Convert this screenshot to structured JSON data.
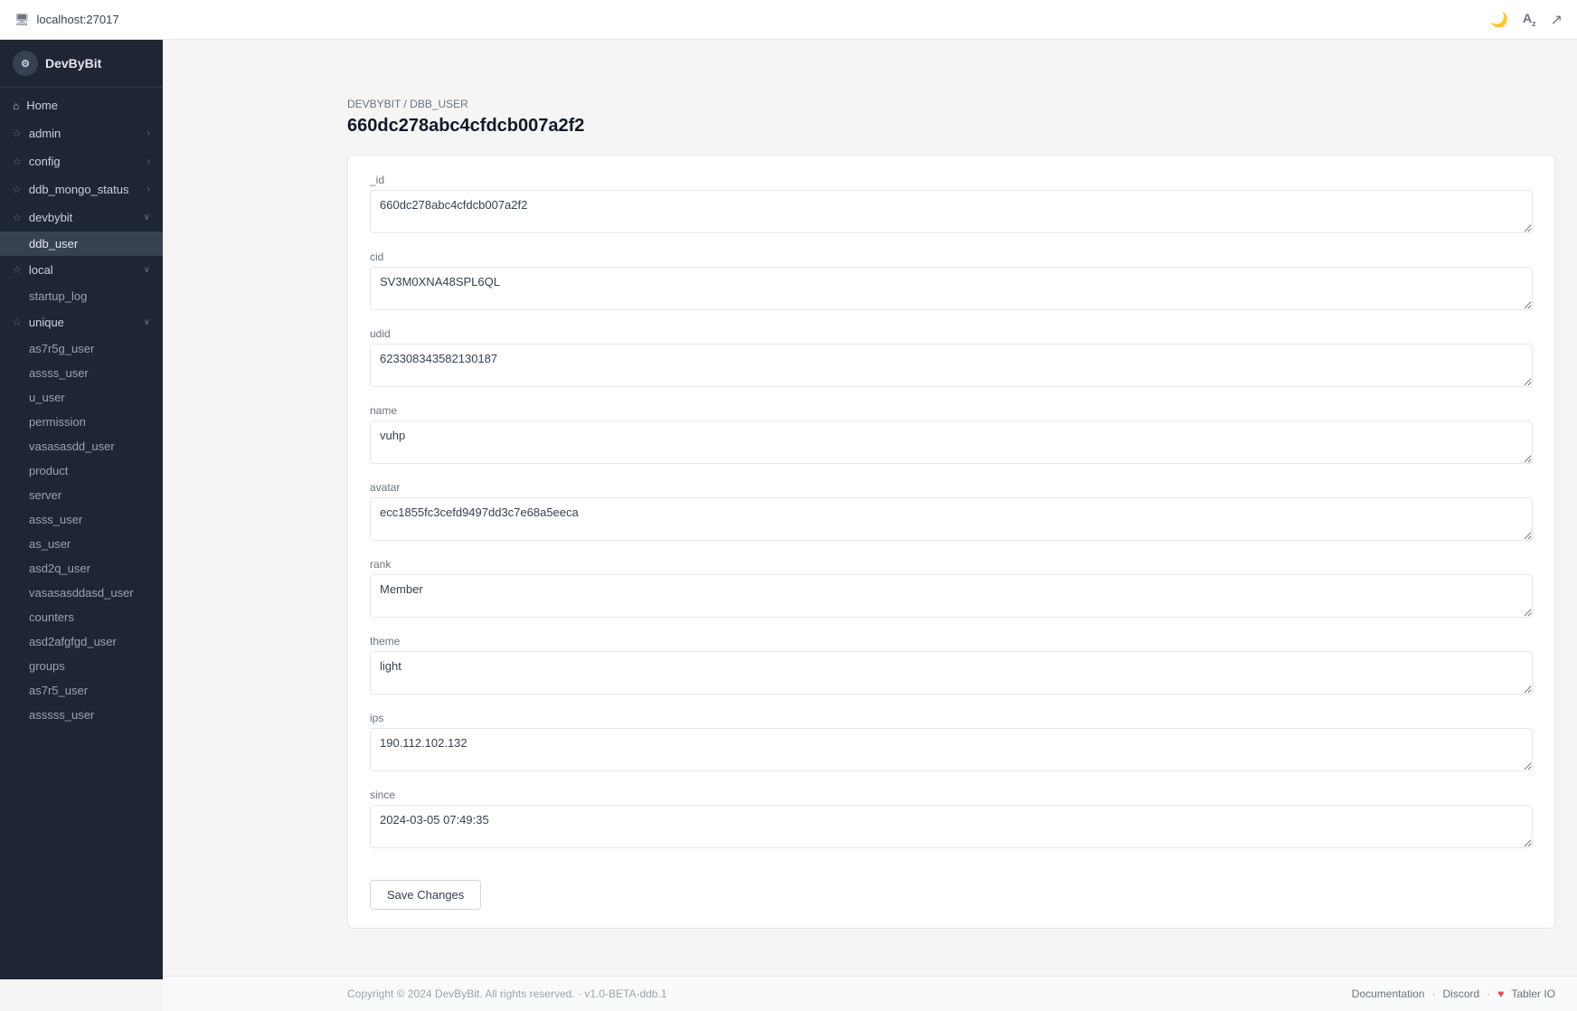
{
  "topbar": {
    "url": "localhost:27017",
    "moon_icon": "🌙",
    "translate_icon": "A",
    "external_icon": "↗"
  },
  "sidebar": {
    "logo": "DevByBit",
    "items": [
      {
        "id": "home",
        "label": "Home",
        "icon": "⌂",
        "hasChildren": false
      },
      {
        "id": "admin",
        "label": "admin",
        "icon": "☆",
        "hasChildren": true,
        "expanded": false
      },
      {
        "id": "config",
        "label": "config",
        "icon": "☆",
        "hasChildren": true,
        "expanded": false
      },
      {
        "id": "ddb_mongo_status",
        "label": "ddb_mongo_status",
        "icon": "☆",
        "hasChildren": true,
        "expanded": false
      },
      {
        "id": "devbybit",
        "label": "devbybit",
        "icon": "☆",
        "hasChildren": true,
        "expanded": true,
        "children": [
          {
            "id": "ddb_user",
            "label": "ddb_user",
            "active": true
          }
        ]
      },
      {
        "id": "local",
        "label": "local",
        "icon": "☆",
        "hasChildren": true,
        "expanded": true,
        "children": [
          {
            "id": "startup_log",
            "label": "startup_log"
          }
        ]
      },
      {
        "id": "unique",
        "label": "unique",
        "icon": "☆",
        "hasChildren": true,
        "expanded": true,
        "children": [
          {
            "id": "as7r5g_user",
            "label": "as7r5g_user"
          },
          {
            "id": "assss_user",
            "label": "assss_user"
          },
          {
            "id": "u_user",
            "label": "u_user"
          },
          {
            "id": "permission",
            "label": "permission"
          },
          {
            "id": "vasasasdd_user",
            "label": "vasasasdd_user"
          },
          {
            "id": "product",
            "label": "product"
          },
          {
            "id": "server",
            "label": "server"
          },
          {
            "id": "asss_user",
            "label": "asss_user"
          },
          {
            "id": "as_user",
            "label": "as_user"
          },
          {
            "id": "asd2q_user",
            "label": "asd2q_user"
          },
          {
            "id": "vasasasddasd_user",
            "label": "vasasasddasd_user"
          },
          {
            "id": "counters",
            "label": "counters"
          },
          {
            "id": "asd2afgfgd_user",
            "label": "asd2afgfgd_user"
          },
          {
            "id": "groups",
            "label": "groups"
          },
          {
            "id": "as7r5_user",
            "label": "as7r5_user"
          },
          {
            "id": "asssss_user",
            "label": "asssss_user"
          }
        ]
      }
    ]
  },
  "breadcrumb": {
    "parent": "DEVBYBIT",
    "separator": "/",
    "current": "DBB_USER"
  },
  "page": {
    "title": "660dc278abc4cfdcb007a2f2"
  },
  "fields": [
    {
      "id": "_id",
      "label": "_id",
      "value": "660dc278abc4cfdcb007a2f2"
    },
    {
      "id": "cid",
      "label": "cid",
      "value": "SV3M0XNA48SPL6QL"
    },
    {
      "id": "udid",
      "label": "udid",
      "value": "623308343582130187"
    },
    {
      "id": "name",
      "label": "name",
      "value": "vuhp"
    },
    {
      "id": "avatar",
      "label": "avatar",
      "value": "ecc1855fc3cefd9497dd3c7e68a5eeca"
    },
    {
      "id": "rank",
      "label": "rank",
      "value": "Member"
    },
    {
      "id": "theme",
      "label": "theme",
      "value": "light"
    },
    {
      "id": "ips",
      "label": "ips",
      "value": "190.112.102.132"
    },
    {
      "id": "since",
      "label": "since",
      "value": "2024-03-05 07:49:35"
    }
  ],
  "save_button": "Save Changes",
  "footer": {
    "copyright": "Copyright © 2024 DevByBit. All rights reserved.",
    "separator": "·",
    "version": "v1.0-BETA-ddb.1",
    "docs": "Documentation",
    "discord": "Discord",
    "tabler": "Tabler IO"
  }
}
